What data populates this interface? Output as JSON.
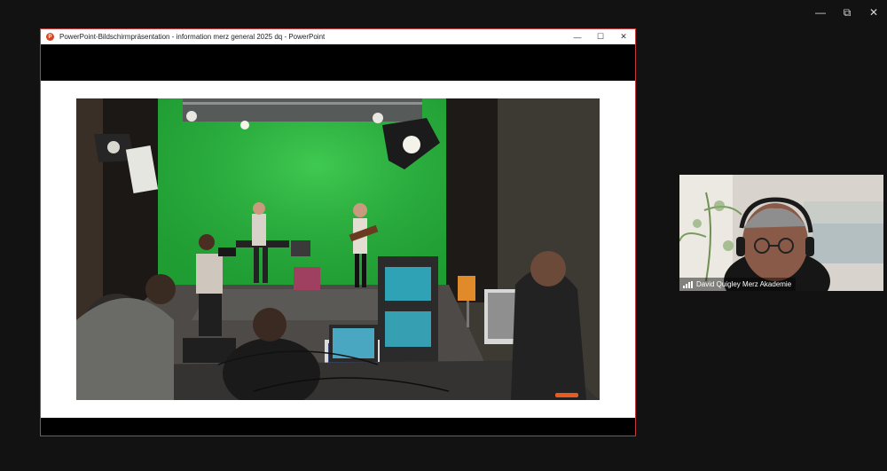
{
  "outer_window": {
    "controls": {
      "minimize": "—",
      "restore": "⧉",
      "close": "✕"
    }
  },
  "ppt": {
    "title": "PowerPoint-Bildschirmpräsentation  -  information merz general 2025 dq  -  PowerPoint",
    "logo_letter": "P",
    "controls": {
      "minimize": "—",
      "maximize": "☐",
      "close": "✕"
    },
    "accent": "#c4393b"
  },
  "slide": {
    "photo_description_icon": "green-screen-studio-photo"
  },
  "video": {
    "participant_name": "David Quigley Merz Akademie"
  }
}
